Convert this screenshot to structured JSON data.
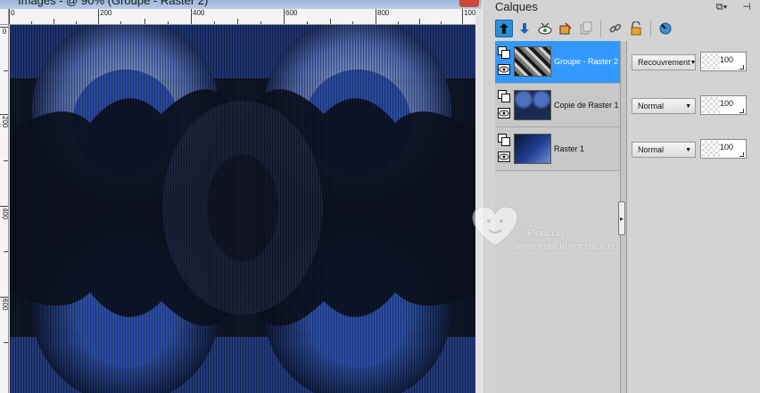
{
  "image_window": {
    "title": "Images - @ 90% (Groupe - Raster 2)",
    "ruler_top_labels": [
      "0",
      "200",
      "400",
      "600",
      "800",
      "100"
    ],
    "ruler_left_labels": [
      "0",
      "200",
      "400",
      "600"
    ]
  },
  "layers_palette": {
    "title": "Calques",
    "header_icons": [
      "dock-icon",
      "pin-icon"
    ],
    "toolbar": [
      {
        "name": "move-layer-up-icon",
        "active": true
      },
      {
        "name": "move-layer-down-icon",
        "active": false
      },
      {
        "name": "visibility-toggle-icon",
        "active": false
      },
      {
        "name": "edit-selection-icon",
        "active": false
      },
      {
        "name": "duplicate-layer-icon",
        "active": false
      },
      {
        "name": "link-icon",
        "active": false
      },
      {
        "name": "lock-icon",
        "active": false
      },
      {
        "name": "view-icon",
        "active": false
      }
    ],
    "layers": [
      {
        "name": "Groupe - Raster 2",
        "blend": "Recouvrement",
        "opacity": "100",
        "selected": true
      },
      {
        "name": "Copie de Raster 1",
        "blend": "Normal",
        "opacity": "100",
        "selected": false
      },
      {
        "name": "Raster 1",
        "blend": "Normal",
        "opacity": "100",
        "selected": false
      }
    ]
  },
  "watermark": {
    "name": "Pinuccia",
    "url": "www.maildiregrafica.eu"
  },
  "colors": {
    "selection": "#3399ff",
    "canvas_dark": "#0d1322",
    "canvas_blue": "#2f56b0"
  }
}
